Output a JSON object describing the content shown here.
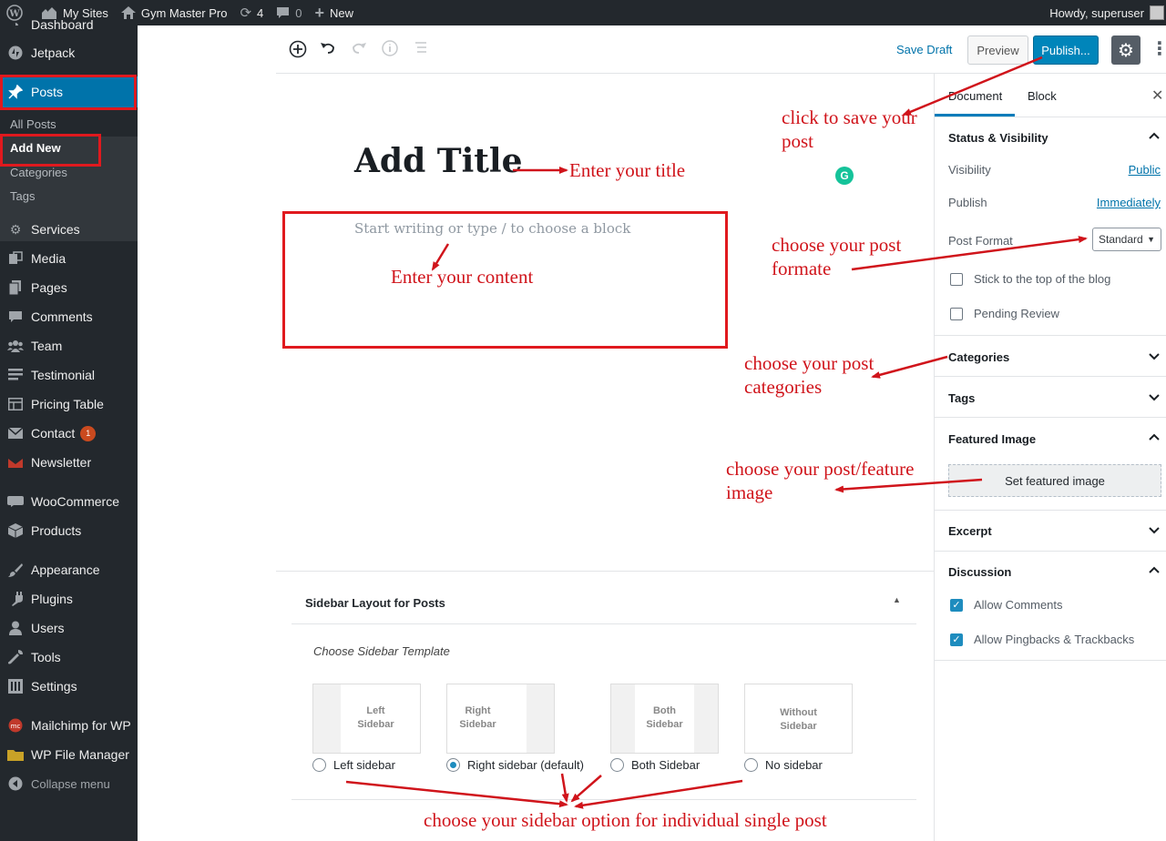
{
  "admin_bar": {
    "sites_label": "My Sites",
    "site_name": "Gym Master Pro",
    "updates_count": "4",
    "comments_count": "0",
    "new_label": "New",
    "greeting": "Howdy, superuser"
  },
  "admin_menu": {
    "items": [
      {
        "label": "Dashboard"
      },
      {
        "label": "Jetpack"
      },
      {
        "label": "Posts"
      },
      {
        "label": "Services"
      },
      {
        "label": "Media"
      },
      {
        "label": "Pages"
      },
      {
        "label": "Comments"
      },
      {
        "label": "Team"
      },
      {
        "label": "Testimonial"
      },
      {
        "label": "Pricing Table"
      },
      {
        "label": "Contact",
        "badge": "1"
      },
      {
        "label": "Newsletter"
      },
      {
        "label": "WooCommerce"
      },
      {
        "label": "Products"
      },
      {
        "label": "Appearance"
      },
      {
        "label": "Plugins"
      },
      {
        "label": "Users"
      },
      {
        "label": "Tools"
      },
      {
        "label": "Settings"
      },
      {
        "label": "Mailchimp for WP"
      },
      {
        "label": "WP File Manager"
      },
      {
        "label": "Collapse menu"
      }
    ],
    "posts_submenu": [
      "All Posts",
      "Add New",
      "Categories",
      "Tags"
    ]
  },
  "toolbar": {
    "save_draft": "Save Draft",
    "preview": "Preview",
    "publish": "Publish..."
  },
  "editor": {
    "title_placeholder": "Add Title",
    "block_placeholder": "Start writing or type / to choose a block"
  },
  "sidebar_layout": {
    "title": "Sidebar Layout for Posts",
    "subtitle": "Choose Sidebar Template",
    "templates": [
      {
        "card_line1": "Left",
        "card_line2": "Sidebar",
        "radio_label": "Left sidebar",
        "selected": false
      },
      {
        "card_line1": "Right",
        "card_line2": "Sidebar",
        "radio_label": "Right sidebar (default)",
        "selected": true
      },
      {
        "card_line1": "Both",
        "card_line2": "Sidebar",
        "radio_label": "Both Sidebar",
        "selected": false
      },
      {
        "card_line1": "Without",
        "card_line2": "Sidebar",
        "radio_label": "No sidebar",
        "selected": false
      }
    ]
  },
  "settings": {
    "tabs": [
      "Document",
      "Block"
    ],
    "status_visibility": {
      "title": "Status & Visibility",
      "visibility_label": "Visibility",
      "visibility_value": "Public",
      "publish_label": "Publish",
      "publish_value": "Immediately",
      "post_format_label": "Post Format",
      "post_format_value": "Standard",
      "sticky_label": "Stick to the top of the blog",
      "pending_label": "Pending Review"
    },
    "categories_title": "Categories",
    "tags_title": "Tags",
    "featured_image": {
      "title": "Featured Image",
      "button": "Set featured image"
    },
    "excerpt_title": "Excerpt",
    "discussion": {
      "title": "Discussion",
      "allow_comments": "Allow Comments",
      "allow_pingbacks": "Allow Pingbacks & Trackbacks"
    }
  },
  "annotations": {
    "title": "Enter your title",
    "content": "Enter your content",
    "save_line1": "click to save your",
    "save_line2": "post",
    "format_line1": "choose your post",
    "format_line2": "formate",
    "categories_line1": "choose your post",
    "categories_line2": "categories",
    "featured_line1": "choose your post/feature",
    "featured_line2": "image",
    "sidebar": "choose your sidebar option for individual single post"
  },
  "colors": {
    "admin_dark": "#23282d",
    "wp_blue": "#0073aa",
    "publish_blue": "#0085ba",
    "annotation_red": "#d0141b",
    "badge_orange": "#ca4a1f"
  }
}
